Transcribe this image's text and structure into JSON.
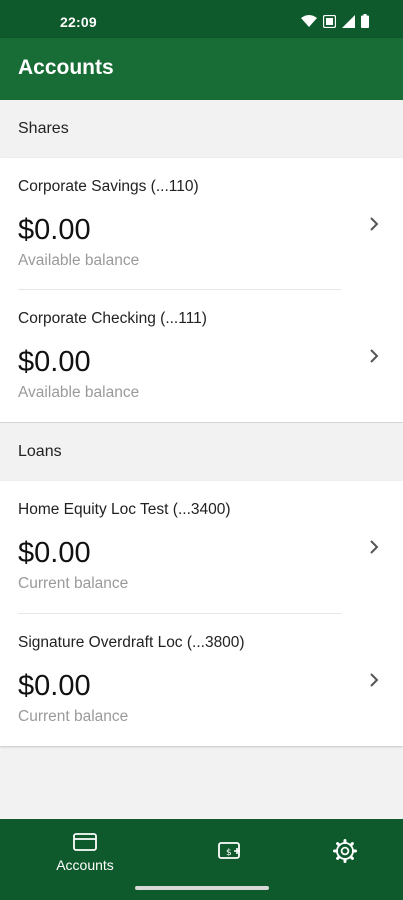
{
  "status_bar": {
    "time": "22:09",
    "icons": [
      "wifi-icon",
      "sim-card-icon",
      "signal-icon",
      "battery-icon"
    ]
  },
  "header": {
    "title": "Accounts"
  },
  "sections": [
    {
      "title": "Shares",
      "accounts": [
        {
          "name": "Corporate Savings (...110)",
          "amount": "$0.00",
          "sub_label": "Available balance"
        },
        {
          "name": "Corporate Checking (...111)",
          "amount": "$0.00",
          "sub_label": "Available balance"
        }
      ]
    },
    {
      "title": "Loans",
      "accounts": [
        {
          "name": "Home Equity Loc Test (...3400)",
          "amount": "$0.00",
          "sub_label": "Current balance"
        },
        {
          "name": "Signature Overdraft Loc (...3800)",
          "amount": "$0.00",
          "sub_label": "Current balance"
        }
      ]
    }
  ],
  "bottom_nav": {
    "items": [
      {
        "label": "Accounts",
        "icon": "wallet-icon",
        "active": true
      },
      {
        "label": "",
        "icon": "deposit-check-icon",
        "active": false
      },
      {
        "label": "",
        "icon": "gear-icon",
        "active": false
      }
    ]
  },
  "colors": {
    "status_bar": "#0f5a2c",
    "app_bar": "#176d35",
    "bottom_nav": "#0f5a2c",
    "background": "#f2f2f2",
    "secondary_text": "#9a9a9a"
  }
}
